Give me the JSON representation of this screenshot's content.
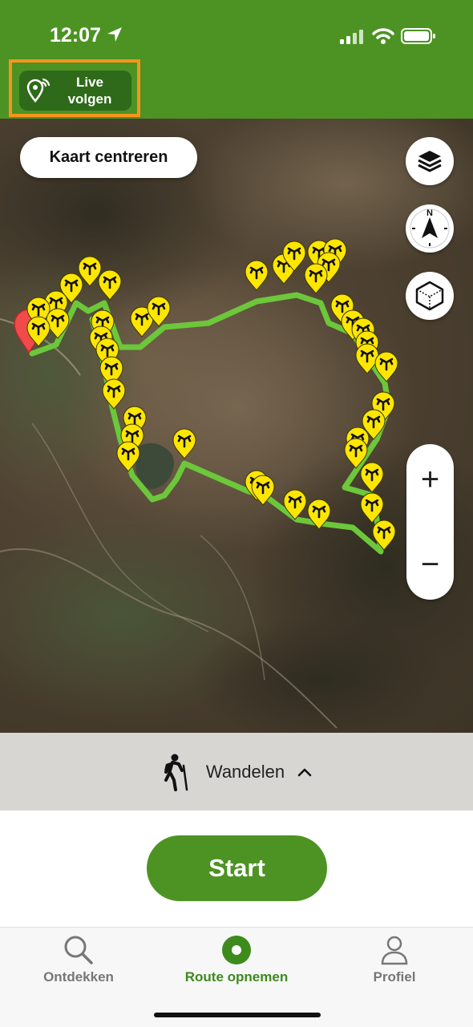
{
  "status_bar": {
    "time": "12:07"
  },
  "header": {
    "live_button": {
      "label_line1": "Live",
      "label_line2": "volgen",
      "icon": "location-broadcast-icon"
    }
  },
  "map": {
    "center_button": "Kaart centreren",
    "layers_icon": "layers-icon",
    "compass_icon": "compass-icon",
    "compass_letter": "N",
    "threed_icon": "3d-cube-icon",
    "zoom_in": "+",
    "zoom_out": "−",
    "route_color": "#6cc83a",
    "marker_color": "#ffe600"
  },
  "activity": {
    "label": "Wandelen",
    "icon": "hiker-icon"
  },
  "start_button": "Start",
  "tabs": [
    {
      "label": "Ontdekken",
      "icon": "search-icon",
      "active": false
    },
    {
      "label": "Route opnemen",
      "icon": "record-icon",
      "active": true
    },
    {
      "label": "Profiel",
      "icon": "person-icon",
      "active": false
    }
  ],
  "colors": {
    "brand_green": "#4c9323",
    "highlight": "#f7941d",
    "active_tab": "#3d8a1d"
  }
}
